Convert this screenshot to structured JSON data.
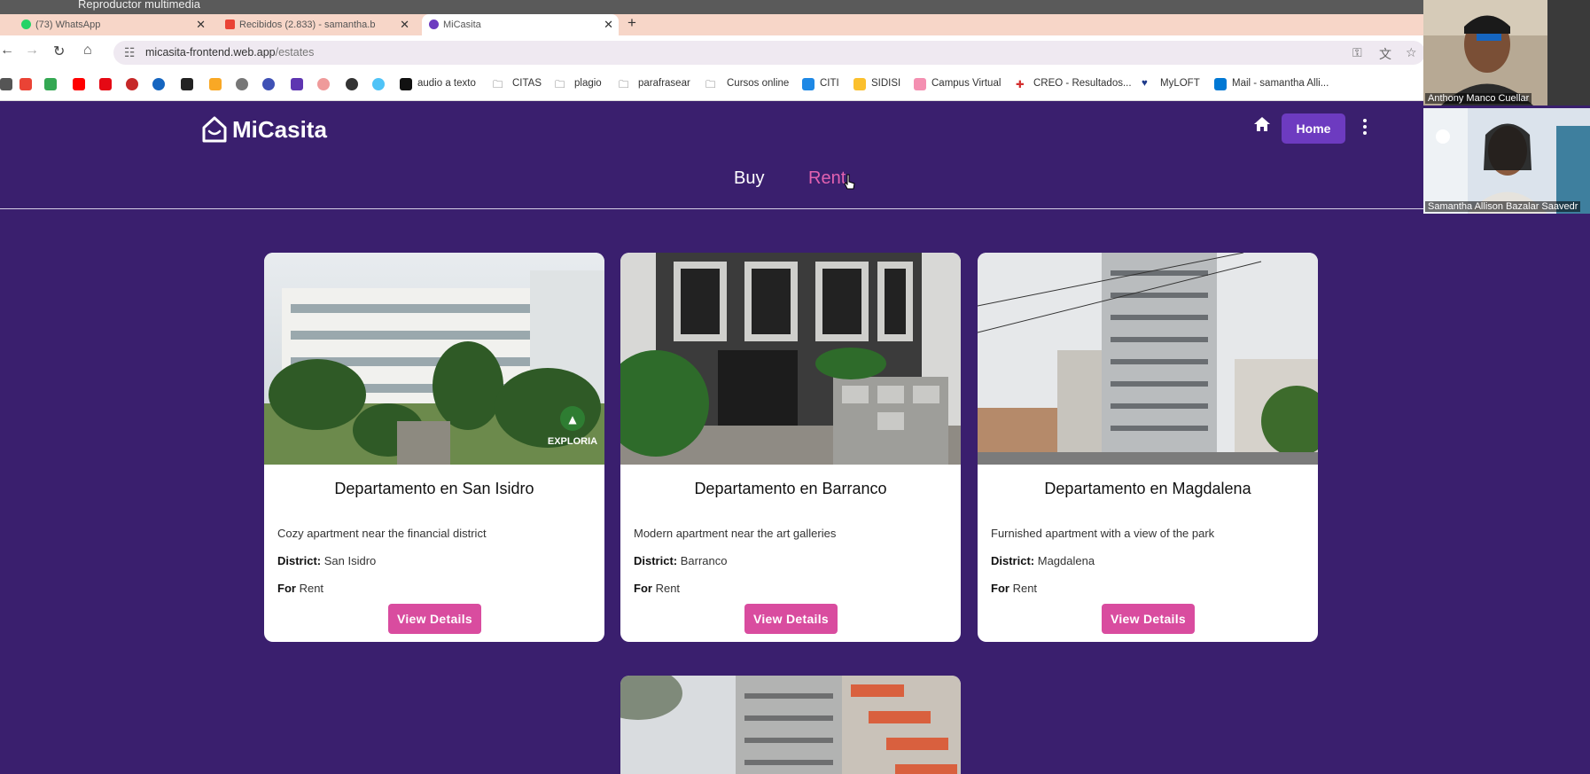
{
  "os": {
    "media_title": "Reproductor multimedia"
  },
  "browser": {
    "tabs": [
      {
        "label": "(73) WhatsApp",
        "icon": "whatsapp-icon",
        "color": "#25d366"
      },
      {
        "label": "Recibidos (2.833) - samantha.b",
        "icon": "gmail-icon",
        "color": "#ea4335"
      },
      {
        "label": "MiCasita",
        "icon": "micasita-icon",
        "color": "#6d3bc0"
      }
    ],
    "url_host": "micasita-frontend.web.app",
    "url_path": "/estates",
    "bookmarks": [
      "audio a texto",
      "CITAS",
      "plagio",
      "parafrasear",
      "Cursos online",
      "CITI",
      "SIDISI",
      "Campus Virtual",
      "CREO - Resultados...",
      "MyLOFT",
      "Mail - samantha Alli..."
    ]
  },
  "app": {
    "brand": "MiCasita",
    "home_label": "Home",
    "nav": {
      "buy": "Buy",
      "rent": "Rent"
    },
    "colors": {
      "background": "#3a1f6e",
      "accent": "#d94c9f",
      "primary_button": "#6d3bc0"
    },
    "listings": [
      {
        "title": "Departamento en San Isidro",
        "description": "Cozy apartment near the financial district",
        "district_label": "District:",
        "district": "San Isidro",
        "for_label": "For",
        "for": "Rent",
        "button": "View Details",
        "watermark": "EXPLORIA"
      },
      {
        "title": "Departamento en Barranco",
        "description": "Modern apartment near the art galleries",
        "district_label": "District:",
        "district": "Barranco",
        "for_label": "For",
        "for": "Rent",
        "button": "View Details"
      },
      {
        "title": "Departamento en Magdalena",
        "description": "Furnished apartment with a view of the park",
        "district_label": "District:",
        "district": "Magdalena",
        "for_label": "For",
        "for": "Rent",
        "button": "View Details"
      }
    ]
  },
  "call": {
    "participants": [
      {
        "name": "Anthony Manco Cuellar"
      },
      {
        "name": "Samantha Allison Bazalar Saavedr"
      }
    ]
  }
}
